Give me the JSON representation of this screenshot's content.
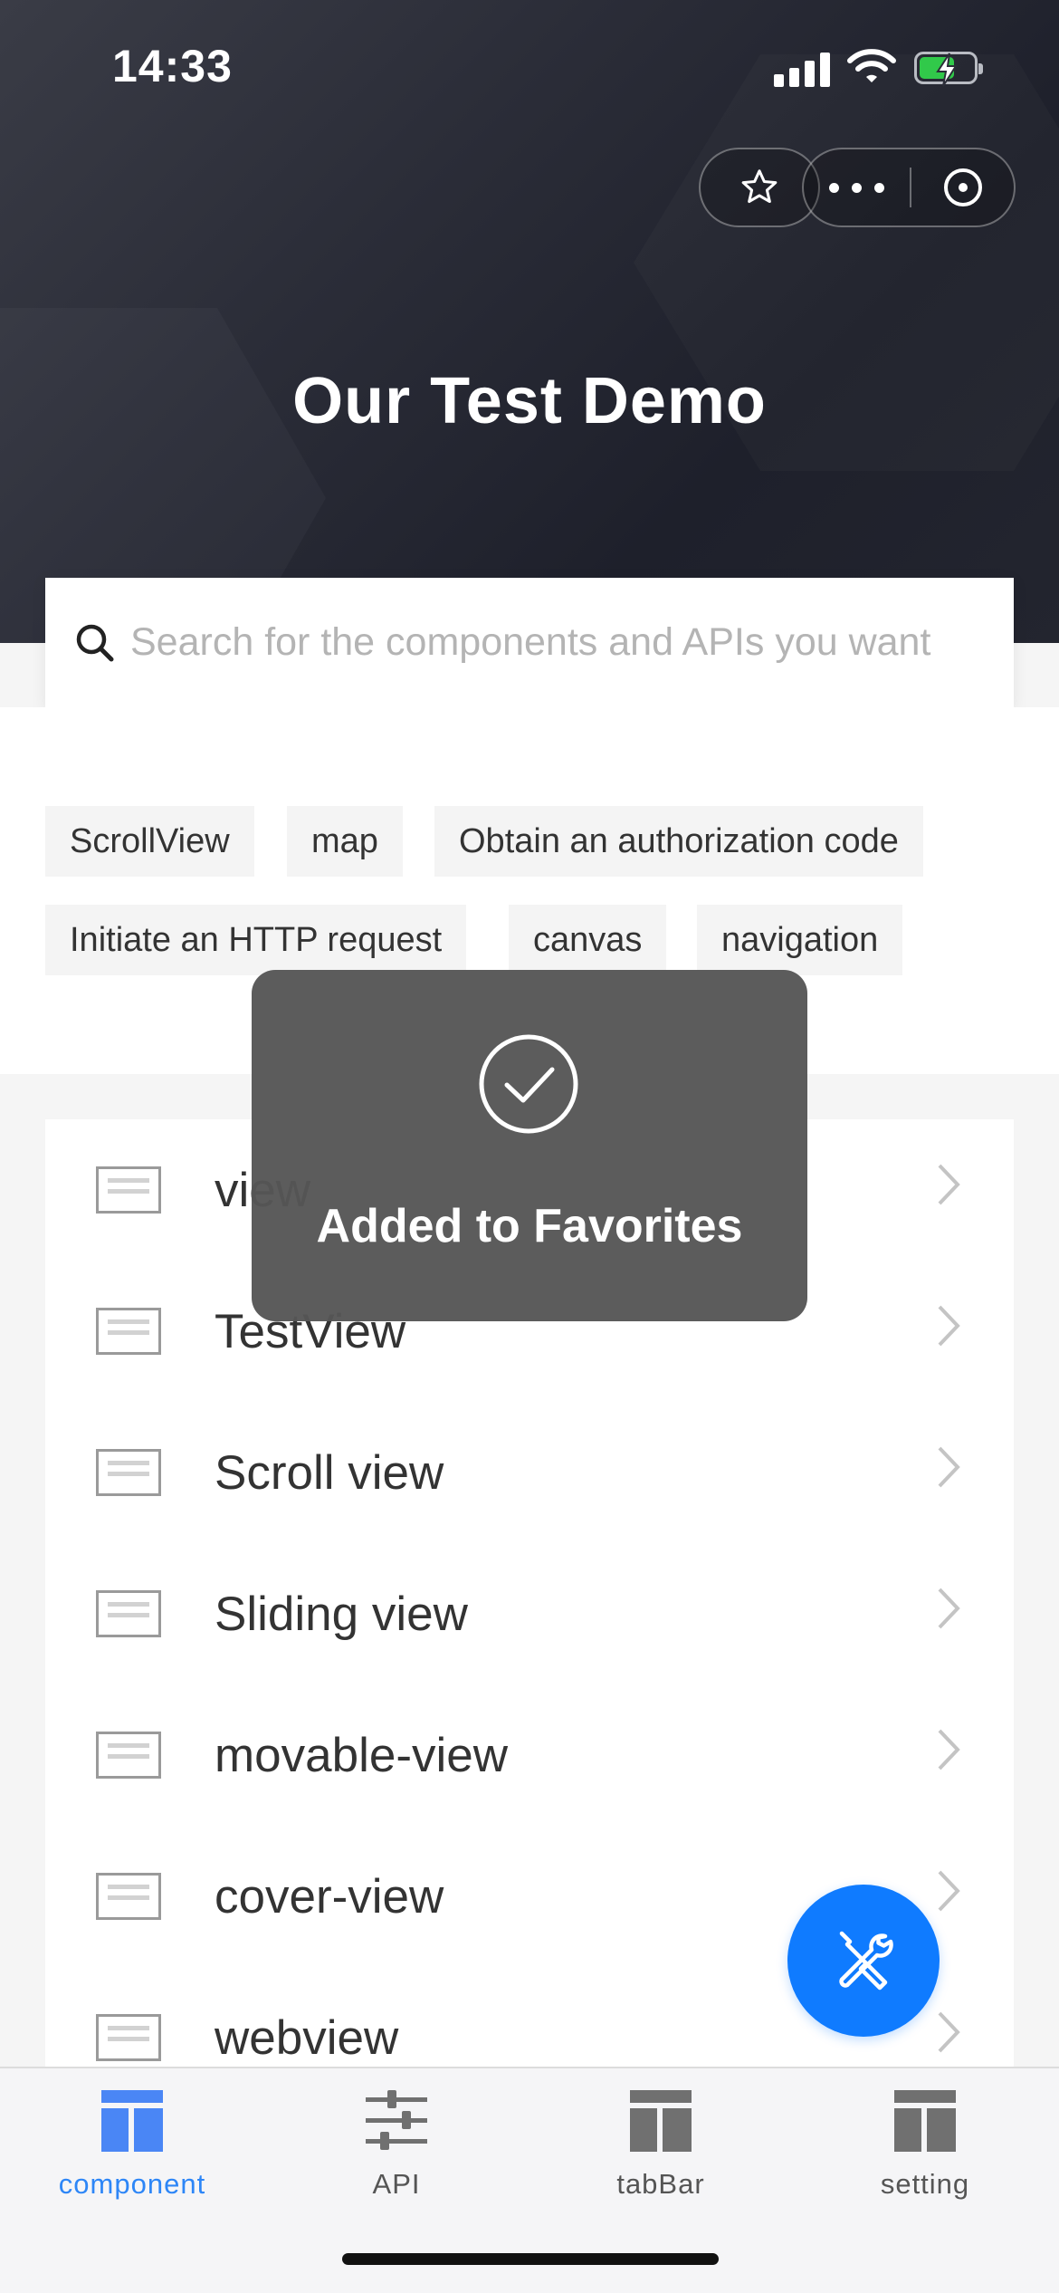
{
  "status_bar": {
    "time": "14:33"
  },
  "header": {
    "title": "Our Test Demo"
  },
  "search": {
    "placeholder": "Search for the components and APIs you want"
  },
  "tags": [
    "ScrollView",
    "map",
    "Obtain an authorization code",
    "Initiate an HTTP request",
    "canvas",
    "navigation"
  ],
  "list": {
    "items": [
      {
        "label": "view"
      },
      {
        "label": "TestView"
      },
      {
        "label": "Scroll view"
      },
      {
        "label": "Sliding view"
      },
      {
        "label": "movable-view"
      },
      {
        "label": "cover-view"
      },
      {
        "label": "webview"
      }
    ]
  },
  "toast": {
    "message": "Added to Favorites",
    "icon": "check-circle-icon"
  },
  "tabbar": {
    "items": [
      {
        "label": "component",
        "active": true
      },
      {
        "label": "API",
        "active": false
      },
      {
        "label": "tabBar",
        "active": false
      },
      {
        "label": "setting",
        "active": false
      }
    ]
  },
  "colors": {
    "accent": "#2d86f7",
    "fab": "#0f7bff",
    "header_dark": "#1e202b"
  }
}
